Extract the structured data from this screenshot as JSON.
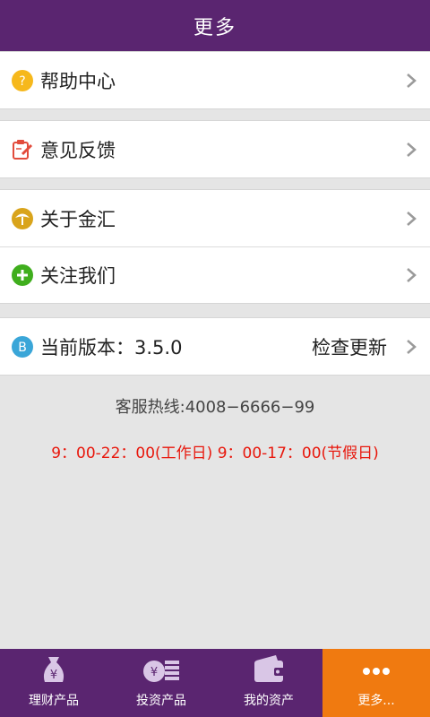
{
  "header": {
    "title": "更多"
  },
  "menu": {
    "help": "帮助中心",
    "feedback": "意见反馈",
    "about": "关于金汇",
    "follow": "关注我们",
    "version": "当前版本：3.5.0",
    "check_update": "检查更新"
  },
  "info": {
    "hotline": "客服热线:4008−6666−99",
    "hours": "9：00-22：00(工作日) 9：00-17：00(节假日)"
  },
  "tabs": [
    {
      "label": "理财产品",
      "icon": "money-bag-icon"
    },
    {
      "label": "投资产品",
      "icon": "coins-icon"
    },
    {
      "label": "我的资产",
      "icon": "wallet-icon"
    },
    {
      "label": "更多...",
      "icon": "more-dots-icon",
      "active": true
    }
  ],
  "colors": {
    "brand": "#5a2570",
    "active_tab": "#f07a10",
    "hours_text": "#e8170c"
  }
}
